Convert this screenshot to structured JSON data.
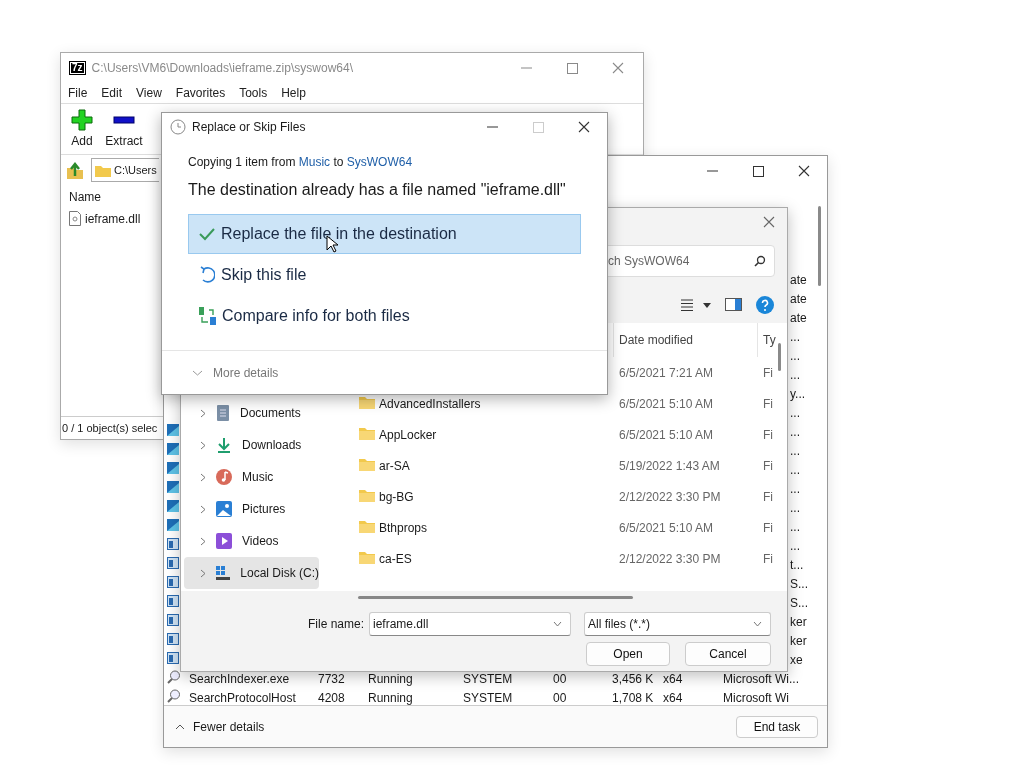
{
  "seven_zip": {
    "logo": "7z",
    "title": "C:\\Users\\VM6\\Downloads\\ieframe.zip\\syswow64\\",
    "menu": [
      "File",
      "Edit",
      "View",
      "Favorites",
      "Tools",
      "Help"
    ],
    "tools": [
      {
        "kind": "add",
        "label": "Add"
      },
      {
        "kind": "extract",
        "label": "Extract"
      }
    ],
    "address": "C:\\Users",
    "columns": [
      "Name"
    ],
    "files": [
      "ieframe.dll"
    ],
    "status": "0 / 1 object(s) selec"
  },
  "task_manager": {
    "rows": [
      {
        "description": "ate"
      },
      {
        "description": "ate"
      },
      {
        "description": "ate"
      },
      {
        "description": "..."
      },
      {
        "description": "..."
      },
      {
        "description": "..."
      },
      {
        "description": "y..."
      },
      {
        "description": "..."
      },
      {
        "kind": "app",
        "description": "..."
      },
      {
        "kind": "app",
        "description": "..."
      },
      {
        "kind": "app",
        "description": "..."
      },
      {
        "kind": "app",
        "description": "..."
      },
      {
        "kind": "app",
        "description": "..."
      },
      {
        "kind": "app",
        "description": "..."
      },
      {
        "kind": "service",
        "description": "..."
      },
      {
        "kind": "service",
        "description": "t..."
      },
      {
        "kind": "service",
        "description": "S..."
      },
      {
        "kind": "service",
        "description": "S..."
      },
      {
        "kind": "service",
        "description": "ker"
      },
      {
        "kind": "service",
        "description": "ker"
      },
      {
        "kind": "service",
        "description": "xe"
      },
      {
        "kind": "search",
        "name": "SearchIndexer.exe",
        "pid": "7732",
        "status": "Running",
        "user": "SYSTEM",
        "cpu": "00",
        "memory": "3,456 K",
        "arch": "x64",
        "description": "Microsoft Wi..."
      },
      {
        "kind": "search",
        "name": "SearchProtocolHost",
        "pid": "4208",
        "status": "Running",
        "user": "SYSTEM",
        "cpu": "00",
        "memory": "1,708 K",
        "arch": "x64",
        "description": "Microsoft Wi"
      }
    ],
    "footer_toggle": "Fewer details",
    "end_task": "End task"
  },
  "file_dialog": {
    "search": {
      "placeholder": "ch SysWOW64"
    },
    "columns": [
      "Date modified",
      "Ty"
    ],
    "nav": [
      {
        "kind": "documents",
        "label": "Documents",
        "selected": false
      },
      {
        "kind": "downloads",
        "label": "Downloads",
        "selected": false
      },
      {
        "kind": "music",
        "label": "Music",
        "selected": false
      },
      {
        "kind": "pictures",
        "label": "Pictures",
        "selected": false
      },
      {
        "kind": "videos",
        "label": "Videos",
        "selected": false
      },
      {
        "kind": "disk",
        "label": "Local Disk (C:)",
        "selected": true
      }
    ],
    "files": [
      {
        "date": "6/5/2021 7:21 AM",
        "type": "Fi"
      },
      {
        "name": "AdvancedInstallers",
        "date": "6/5/2021 5:10 AM",
        "type": "Fi"
      },
      {
        "name": "AppLocker",
        "date": "6/5/2021 5:10 AM",
        "type": "Fi"
      },
      {
        "name": "ar-SA",
        "date": "5/19/2022 1:43 AM",
        "type": "Fi"
      },
      {
        "name": "bg-BG",
        "date": "2/12/2022 3:30 PM",
        "type": "Fi"
      },
      {
        "name": "Bthprops",
        "date": "6/5/2021 5:10 AM",
        "type": "Fi"
      },
      {
        "name": "ca-ES",
        "date": "2/12/2022 3:30 PM",
        "type": "Fi"
      }
    ],
    "file_name_label": "File name:",
    "file_name": "ieframe.dll",
    "filter": "All files (*.*)",
    "buttons": [
      "Open",
      "Cancel"
    ]
  },
  "replace_dialog": {
    "title": "Replace or Skip Files",
    "info": {
      "prefix": "Copying 1 item from ",
      "source": "Music",
      "middle": " to ",
      "target": "SysWOW64"
    },
    "headline": "The destination already has a file named \"ieframe.dll\"",
    "options": [
      {
        "kind": "replace",
        "label": "Replace the file in the destination",
        "selected": true
      },
      {
        "kind": "skip",
        "label": "Skip this file",
        "selected": false
      },
      {
        "kind": "compare",
        "label": "Compare info for both files",
        "selected": false
      }
    ],
    "more": "More details"
  }
}
